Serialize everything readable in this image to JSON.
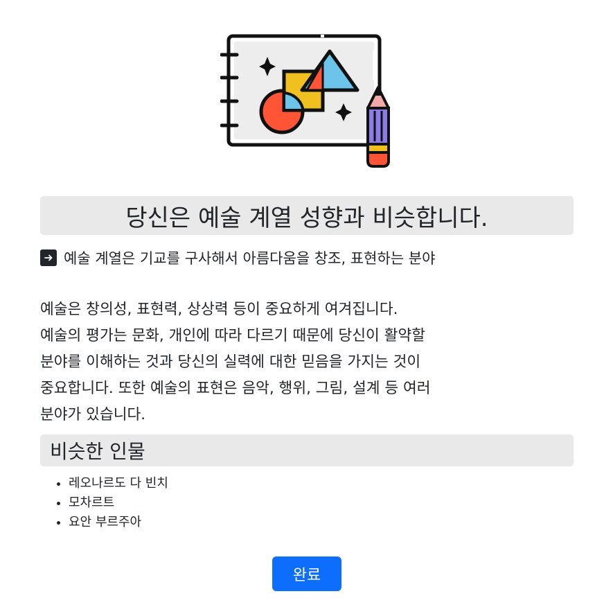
{
  "hero": {
    "icon": "art-sketchbook-shapes-pencil-illustration"
  },
  "result": {
    "title": "당신은 예술 계열 성향과 비슷합니다.",
    "definition_icon": "arrow-right-square-icon",
    "definition": "예술 계열은 기교를 구사해서 아름다움을 창조, 표현하는 분야",
    "description_lines": [
      "예술은 창의성, 표현력, 상상력 등이 중요하게 여겨집니다.",
      "예술의 평가는 문화, 개인에 따라 다르기 때문에 당신이 활약할",
      "분야를 이해하는 것과 당신의 실력에 대한 믿음을 가지는 것이",
      "중요합니다. 또한 예술의 표현은 음악, 행위, 그림, 설계 등 여러",
      "분야가 있습니다."
    ]
  },
  "similar": {
    "heading": "비슷한 인물",
    "people": [
      "레오나르도 다 빈치",
      "모차르트",
      "요안 부르주아"
    ]
  },
  "actions": {
    "done_label": "완료"
  },
  "colors": {
    "accent": "#0d6efd",
    "section_bg": "#e9e9e9",
    "text": "#212529"
  }
}
